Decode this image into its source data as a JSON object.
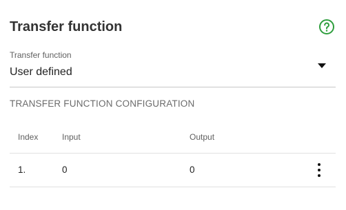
{
  "panel": {
    "title": "Transfer function",
    "help_icon": "help-circle-icon"
  },
  "transfer_select": {
    "label": "Transfer function",
    "value": "User defined",
    "arrow_icon": "dropdown-arrow-icon"
  },
  "config": {
    "heading": "TRANSFER FUNCTION CONFIGURATION",
    "columns": {
      "index": "Index",
      "input": "Input",
      "output": "Output"
    },
    "rows": [
      {
        "index": "1.",
        "input": "0",
        "output": "0",
        "menu_icon": "more-vert-icon"
      }
    ]
  },
  "colors": {
    "help_icon": "#2e9e3d",
    "divider": "#e0e0e0"
  }
}
